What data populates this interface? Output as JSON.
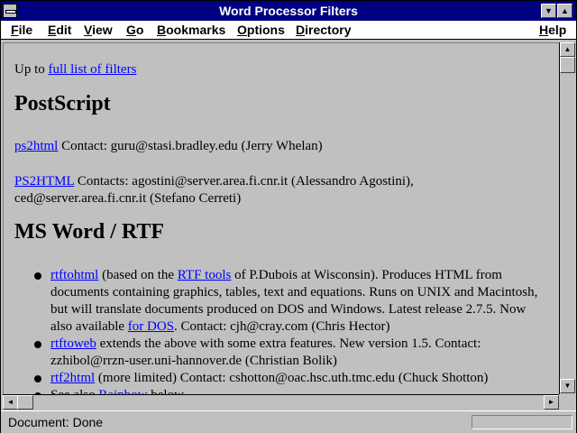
{
  "window": {
    "title": "Word Processor Filters",
    "min_glyph": "▼",
    "max_glyph": "▲"
  },
  "menu": {
    "file": "File",
    "edit": "Edit",
    "view": "View",
    "go": "Go",
    "bookmarks": "Bookmarks",
    "options": "Options",
    "directory": "Directory",
    "help": "Help"
  },
  "document": {
    "upto_prefix": "Up to ",
    "upto_link": "full list of filters",
    "heading_postscript": "PostScript",
    "ps2html_link": "ps2html",
    "ps2html_text": " Contact: guru@stasi.bradley.edu (Jerry Whelan)",
    "PS2HTML_link": "PS2HTML",
    "PS2HTML_text": " Contacts: agostini@server.area.fi.cnr.it (Alessandro Agostini), ced@server.area.fi.cnr.it (Stefano Cerreti)",
    "heading_msword": "MS Word / RTF",
    "items": [
      {
        "link1": "rtftohtml",
        "text1": " (based on the ",
        "link2": "RTF tools",
        "text2": " of P.Dubois at Wisconsin). Produces HTML from documents containing graphics, tables, text and equations. Runs on UNIX and Macintosh, but will translate documents produced on DOS and Windows. Latest release 2.7.5. Now also available ",
        "link3": "for DOS",
        "text3": ". Contact: cjh@cray.com (Chris Hector)"
      },
      {
        "link1": "rtftoweb",
        "text1": " extends the above with some extra features. New version 1.5. Contact: zzhibol@rrzn-user.uni-hannover.de (Christian Bolik)"
      },
      {
        "link1": "rtf2html",
        "text1": " (more limited) Contact: cshotton@oac.hsc.uth.tmc.edu (Chuck Shotton)"
      },
      {
        "text0": "See also ",
        "link1": "Rainbow",
        "text1": " below"
      }
    ]
  },
  "scroll": {
    "up": "▲",
    "down": "▼",
    "left": "◄",
    "right": "►"
  },
  "status": {
    "text": "Document: Done"
  }
}
